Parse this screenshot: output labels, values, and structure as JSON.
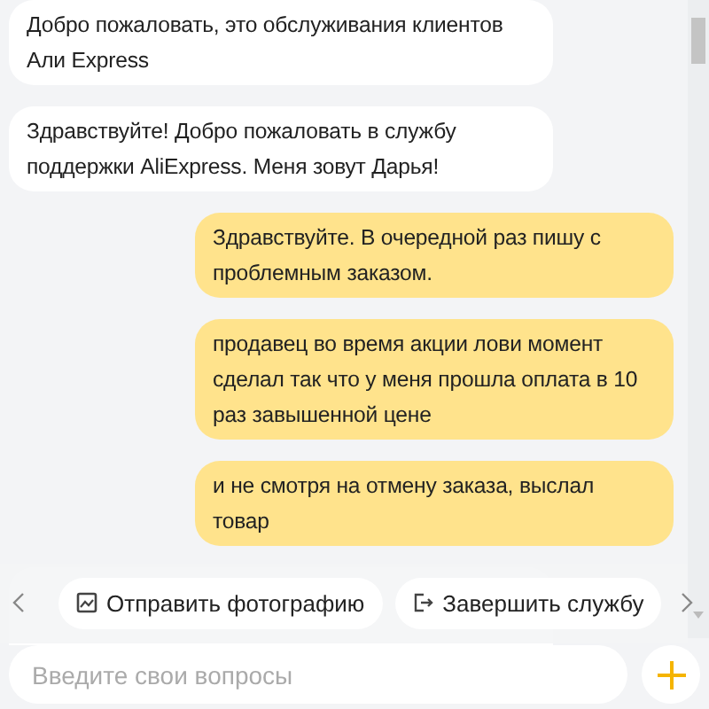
{
  "messages": [
    {
      "kind": "agent",
      "text": "Добро пожаловать, это обслуживания клиентов Али Express"
    },
    {
      "kind": "agent",
      "text": "Здравствуйте! Добро пожаловать в службу поддержки AliExpress. Меня зовут Дарья!"
    },
    {
      "kind": "user",
      "text": "Здравствуйте. В очередной раз пишу с проблемным заказом."
    },
    {
      "kind": "user",
      "text": "продавец во время акции лови момент сделал так что у меня прошла оплата в 10 раз завышенной цене"
    },
    {
      "kind": "user",
      "text": "и не смотря на отмену заказа, выслал товар"
    }
  ],
  "quick_actions": [
    {
      "kind": "photo",
      "label": "Отправить фотографию"
    },
    {
      "kind": "exit",
      "label": "Завершить службу"
    }
  ],
  "input": {
    "placeholder": "Введите свои вопросы"
  }
}
